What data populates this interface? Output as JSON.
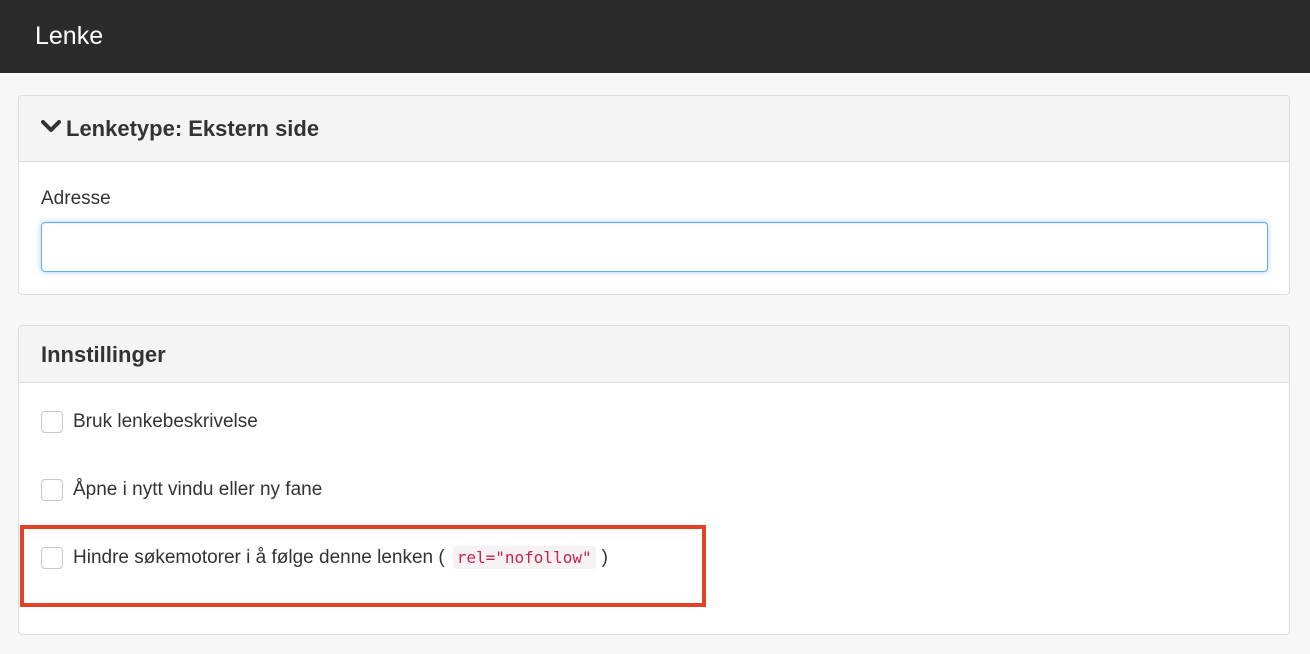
{
  "topbar": {
    "title": "Lenke"
  },
  "link_panel": {
    "title": "Lenketype: Ekstern side",
    "address_label": "Adresse",
    "address_value": ""
  },
  "settings_panel": {
    "title": "Innstillinger",
    "options": [
      {
        "label": "Bruk lenkebeskrivelse",
        "checked": false
      },
      {
        "label": "Åpne i nytt vindu eller ny fane",
        "checked": false
      },
      {
        "label_prefix": "Hindre søkemotorer i å følge denne lenken (",
        "code": "rel=\"nofollow\"",
        "label_suffix": ")",
        "checked": false,
        "highlighted": true
      }
    ]
  },
  "colors": {
    "topbar_bg": "#2b2b2b",
    "focus_border": "#66afe9",
    "highlight": "#e34128",
    "code_text": "#c7254e"
  },
  "icons": {
    "collapse": "chevron-down-icon"
  }
}
